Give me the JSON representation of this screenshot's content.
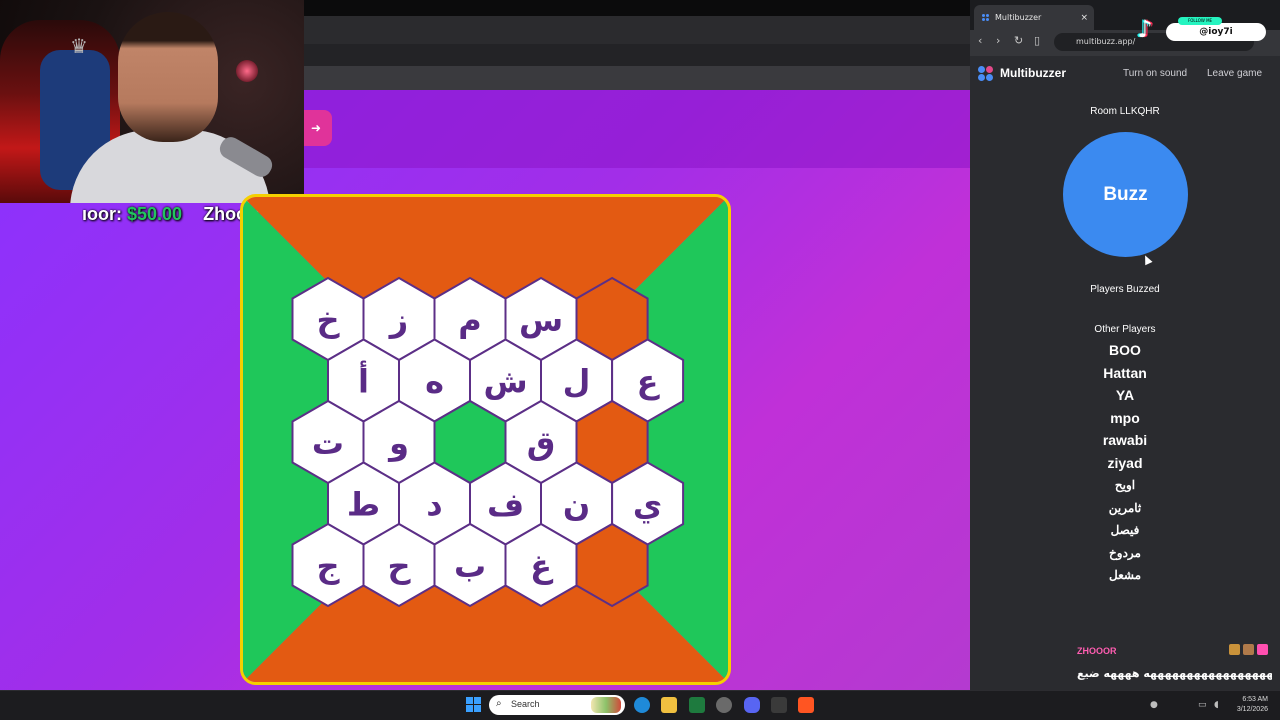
{
  "webcam": {
    "overlay": "stream-webcam"
  },
  "ticker": {
    "entries": [
      {
        "name": "ıoor:",
        "amount": "$50.00"
      },
      {
        "name": "Zhoor:",
        "amount": "$"
      }
    ]
  },
  "board": {
    "colors": {
      "orange": "#e35a12",
      "green": "#1fc75a",
      "hex_fill": "#ffffff",
      "hex_stroke": "#5c2f87",
      "letter": "#5a2b86",
      "frame": "#f5d000"
    },
    "rows": [
      [
        "خ",
        "ز",
        "م",
        "س",
        "#orange"
      ],
      [
        "أ",
        "ه",
        "ش",
        "ل",
        "ع"
      ],
      [
        "ت",
        "و",
        "#green",
        "ق",
        "#orange"
      ],
      [
        "ط",
        "د",
        "ف",
        "ن",
        "ي"
      ],
      [
        "ج",
        "ح",
        "ب",
        "غ",
        "#orange"
      ]
    ]
  },
  "sidebar": {
    "tab_title": "Multibuzzer",
    "tab_close": "×",
    "url": "multibuzz.app/",
    "tiktok_handle": "@ioy7i",
    "tiktok_follow": "FOLLOW ME",
    "app_name": "Multibuzzer",
    "turn_on_sound": "Turn on sound",
    "leave_game": "Leave game",
    "room_label": "Room LLKQHR",
    "buzz_label": "Buzz",
    "players_buzzed": "Players Buzzed",
    "other_players_label": "Other Players",
    "other_players": [
      "BOO",
      "Hattan",
      "YA",
      "mpo",
      "rawabi",
      "ziyad",
      "اويح",
      "ثامرين",
      "فيصل",
      "مردوخ",
      "مشعل"
    ]
  },
  "chat": {
    "username": "ZHOOOR",
    "message": "هههههههههههههههههههههههههههه ههههه ضيع"
  },
  "taskbar": {
    "search_placeholder": "Search",
    "time": "6:53 AM",
    "date": "3/12/2026"
  }
}
